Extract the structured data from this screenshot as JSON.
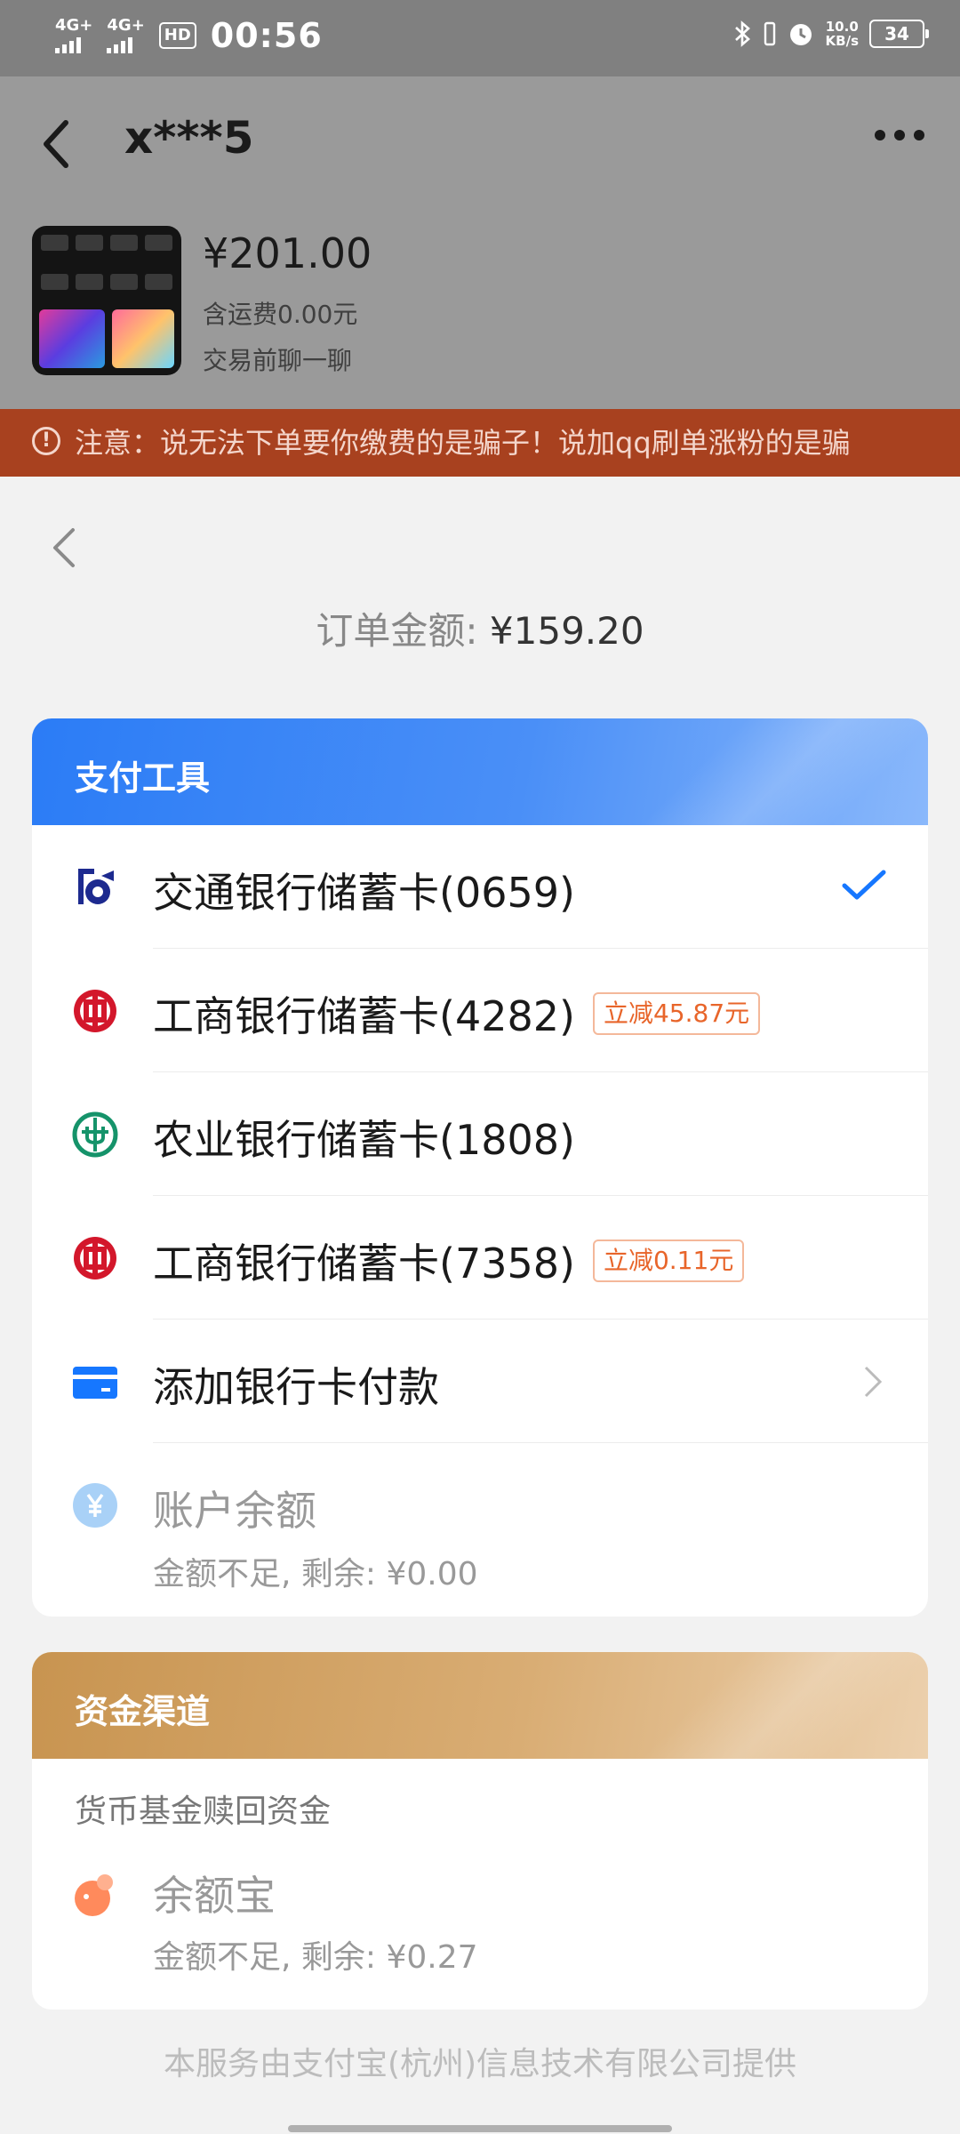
{
  "status_bar": {
    "signal1": "4G+",
    "signal2": "4G+",
    "hd": "HD",
    "time": "00:56",
    "speed_value": "10.0",
    "speed_unit": "KB/s",
    "battery": "34",
    "icons": [
      "bluetooth-icon",
      "vibrate-icon",
      "alarm-icon"
    ]
  },
  "chat": {
    "title": "x***5",
    "price": "¥201.00",
    "shipping": "含运费0.00元",
    "chat_hint": "交易前聊一聊",
    "warning": "注意：说无法下单要你缴费的是骗子！说加qq刷单涨粉的是骗"
  },
  "sheet": {
    "order_label": "订单金额:",
    "order_amount": "¥159.20",
    "pay_tools": {
      "title": "支付工具",
      "items": [
        {
          "label": "交通银行储蓄卡(0659)",
          "promo": "",
          "icon": "bocom-icon",
          "selected": true
        },
        {
          "label": "工商银行储蓄卡(4282)",
          "promo": "立减45.87元",
          "icon": "icbc-icon",
          "selected": false
        },
        {
          "label": "农业银行储蓄卡(1808)",
          "promo": "",
          "icon": "abc-icon",
          "selected": false
        },
        {
          "label": "工商银行储蓄卡(7358)",
          "promo": "立减0.11元",
          "icon": "icbc-icon",
          "selected": false
        }
      ],
      "add_card": "添加银行卡付款",
      "balance": {
        "label": "账户余额",
        "sub": "金额不足, 剩余: ¥0.00"
      }
    },
    "fund_channel": {
      "title": "资金渠道",
      "subtitle": "货币基金赎回资金",
      "item": {
        "label": "余额宝",
        "sub": "金额不足, 剩余: ¥0.27"
      }
    },
    "footer": "本服务由支付宝(杭州)信息技术有限公司提供"
  },
  "colors": {
    "accent_blue": "#2b7cf6",
    "warning_bg": "#a8411f",
    "promo_orange": "#e8652a",
    "gold": "#c89450"
  }
}
